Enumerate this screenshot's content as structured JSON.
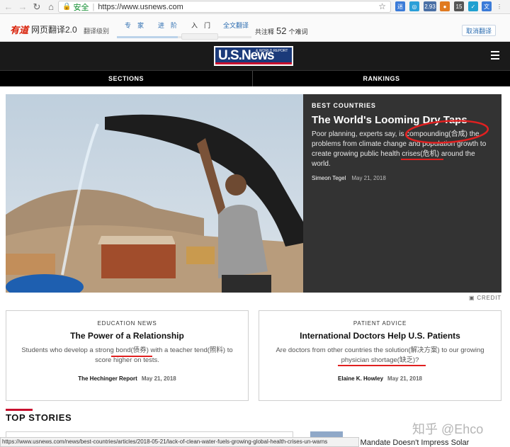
{
  "browser": {
    "secure_label": "安全",
    "url": "https://www.usnews.com",
    "extensions": [
      {
        "label": "迷",
        "color": "#3b7bd8"
      },
      {
        "label": "◎",
        "color": "#2a9fd8"
      },
      {
        "label": "2.93",
        "color": "#4a6fa5"
      },
      {
        "label": "●",
        "color": "#e07a20"
      },
      {
        "label": "15",
        "color": "#555555"
      },
      {
        "label": "✓",
        "color": "#20a0d0"
      },
      {
        "label": "文",
        "color": "#3b7bd8"
      },
      {
        "label": "◆",
        "color": "#555555"
      }
    ]
  },
  "youdao": {
    "logo": "有道",
    "name": "网页翻译2.0",
    "level_label": "翻译级别",
    "options": [
      "专　家",
      "进　阶",
      "入　门",
      "全文翻译"
    ],
    "active_option": "入　门",
    "count_prefix": "共注释",
    "count": "52",
    "count_suffix": "个难词",
    "cancel": "取消翻译"
  },
  "site": {
    "logo_us": "U.S.News",
    "logo_wr": "& WORLD REPORT",
    "nav": [
      "SECTIONS",
      "RANKINGS"
    ]
  },
  "hero": {
    "kicker": "BEST COUNTRIES",
    "title": "The World's Looming Dry Taps",
    "body": "Poor planning, experts say, is compounding(合成) the problems from climate change and population growth to create growing public health crises(危机) around the world.",
    "author": "Simeon Tegel",
    "date": "May 21, 2018",
    "credit": "CREDIT"
  },
  "cards": [
    {
      "kicker": "EDUCATION NEWS",
      "title": "The Power of a Relationship",
      "body": "Students who develop a strong bond(债券) with a teacher tend(照料) to score higher on tests.",
      "author": "The Hechinger Report",
      "date": "May 21, 2018"
    },
    {
      "kicker": "PATIENT ADVICE",
      "title": "International Doctors Help U.S. Patients",
      "body": "Are doctors from other countries the solution(解决方案) to our growing physician shortage(缺乏)?",
      "author": "Elaine K. Howley",
      "date": "May 21, 2018"
    }
  ],
  "top_stories": {
    "title": "TOP STORIES",
    "story_text": "v Mandate Doesn't Impress Solar"
  },
  "status_url": "https://www.usnews.com/news/best-countries/articles/2018-05-21/lack-of-clean-water-fuels-growing-global-health-crises-un-warns",
  "watermark": "知乎 @Ehco"
}
